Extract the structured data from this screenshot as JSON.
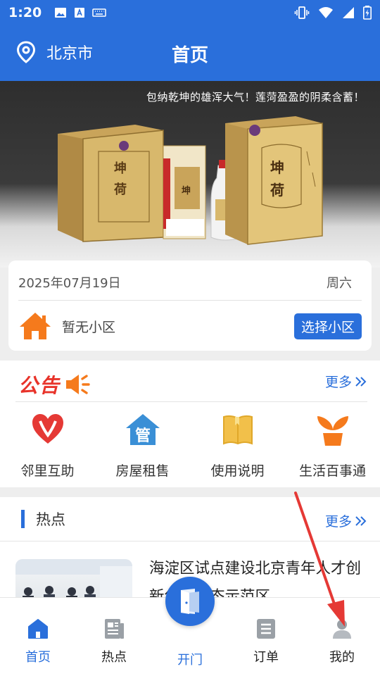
{
  "status_bar": {
    "time": "1:20",
    "left_icons": [
      "image-icon",
      "font-download-icon",
      "keyboard-icon"
    ],
    "right_icons": [
      "vibrate-icon",
      "wifi-icon",
      "signal-icon",
      "battery-icon"
    ]
  },
  "header": {
    "location": "北京市",
    "title": "首页"
  },
  "banner": {
    "slogan": "包纳乾坤的雄浑大气！莲菏盈盈的阴柔含蓄！"
  },
  "date_card": {
    "date": "2025年07月19日",
    "weekday": "周六",
    "community": "暂无小区",
    "select_button": "选择小区"
  },
  "notice": {
    "label": "公告",
    "more": "更多"
  },
  "services": [
    {
      "label": "邻里互助",
      "icon": "heart-icon"
    },
    {
      "label": "房屋租售",
      "icon": "house-icon",
      "glyph": "管"
    },
    {
      "label": "使用说明",
      "icon": "book-icon"
    },
    {
      "label": "生活百事通",
      "icon": "plant-icon"
    }
  ],
  "hot": {
    "title": "热点",
    "more": "更多",
    "headline": "海淀区试点建设北京青年人才创新创业生态示范区"
  },
  "tabs": [
    {
      "label": "首页",
      "active": true
    },
    {
      "label": "热点"
    },
    {
      "label": "开门"
    },
    {
      "label": "订单"
    },
    {
      "label": "我的"
    }
  ],
  "colors": {
    "primary": "#2a6fdb",
    "notice_red": "#e8332a",
    "house_orange": "#f57a1c",
    "annotation_arrow": "#e53935"
  }
}
